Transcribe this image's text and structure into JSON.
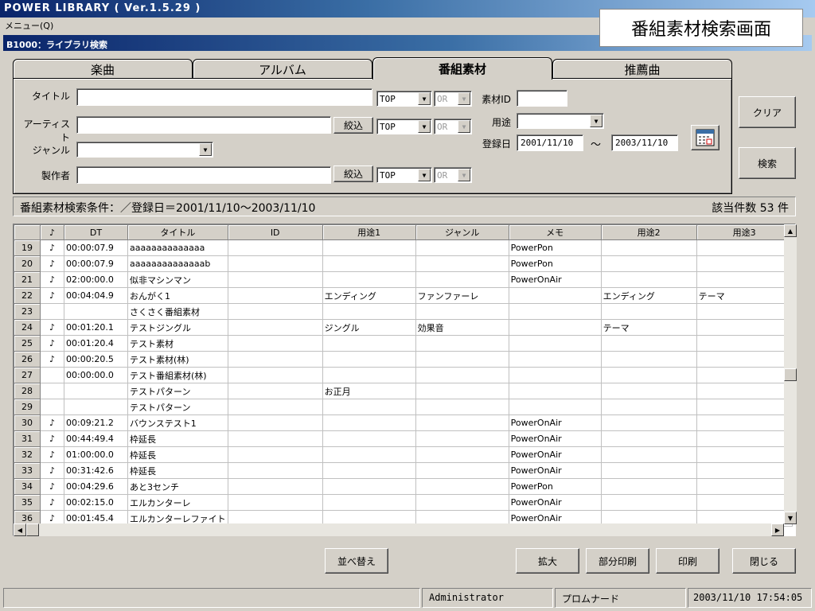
{
  "app": {
    "title": "POWER LIBRARY ( Ver.1.5.29 )",
    "menu": "メニュー(Q)",
    "window_title": "B1000：ライブラリ検索",
    "caption": "番組素材検索画面"
  },
  "tabs": [
    {
      "label": "楽曲"
    },
    {
      "label": "アルバム"
    },
    {
      "label": "番組素材"
    },
    {
      "label": "推薦曲"
    }
  ],
  "form": {
    "title_label": "タイトル",
    "artist_label": "アーティスト",
    "genre_label": "ジャンル",
    "producer_label": "製作者",
    "title_value": "",
    "artist_value": "",
    "genre_value": "",
    "producer_value": "",
    "narrow_label": "絞込",
    "top": "TOP",
    "or": "OR",
    "material_id_label": "素材ID",
    "material_id_value": "",
    "usage_label": "用途",
    "usage_value": "",
    "reg_date_label": "登録日",
    "date_from": "2001/11/10",
    "tilde": "～",
    "date_to": "2003/11/10"
  },
  "buttons": {
    "clear": "クリア",
    "search": "検索",
    "sort": "並べ替え",
    "zoom": "拡大",
    "partial_print": "部分印刷",
    "print": "印刷",
    "close": "閉じる"
  },
  "search_status": {
    "condition": "番組素材検索条件：／登録日＝2001/11/10～2003/11/10",
    "count": "該当件数 53 件"
  },
  "table": {
    "columns": [
      "♪",
      "DT",
      "タイトル",
      "ID",
      "用途1",
      "ジャンル",
      "メモ",
      "用途2",
      "用途3"
    ],
    "rows": [
      {
        "no": "19",
        "note": "♪",
        "dt": "00:00:07.9",
        "title": "aaaaaaaaaaaaaa",
        "id": "",
        "use1": "",
        "genre": "",
        "memo": "PowerPon",
        "use2": "",
        "use3": ""
      },
      {
        "no": "20",
        "note": "♪",
        "dt": "00:00:07.9",
        "title": "aaaaaaaaaaaaaab",
        "id": "",
        "use1": "",
        "genre": "",
        "memo": "PowerPon",
        "use2": "",
        "use3": ""
      },
      {
        "no": "21",
        "note": "♪",
        "dt": "02:00:00.0",
        "title": "似非マシンマン",
        "id": "",
        "use1": "",
        "genre": "",
        "memo": "PowerOnAir",
        "use2": "",
        "use3": ""
      },
      {
        "no": "22",
        "note": "♪",
        "dt": "00:04:04.9",
        "title": "おんがく1",
        "id": "",
        "use1": "エンディング",
        "genre": "ファンファーレ",
        "memo": "",
        "use2": "エンディング",
        "use3": "テーマ"
      },
      {
        "no": "23",
        "note": "",
        "dt": "",
        "title": "さくさく番組素材",
        "id": "",
        "use1": "",
        "genre": "",
        "memo": "",
        "use2": "",
        "use3": ""
      },
      {
        "no": "24",
        "note": "♪",
        "dt": "00:01:20.1",
        "title": "テストジングル",
        "id": "",
        "use1": "ジングル",
        "genre": "効果音",
        "memo": "",
        "use2": "テーマ",
        "use3": ""
      },
      {
        "no": "25",
        "note": "♪",
        "dt": "00:01:20.4",
        "title": "テスト素材",
        "id": "",
        "use1": "",
        "genre": "",
        "memo": "",
        "use2": "",
        "use3": ""
      },
      {
        "no": "26",
        "note": "♪",
        "dt": "00:00:20.5",
        "title": "テスト素材(林)",
        "id": "",
        "use1": "",
        "genre": "",
        "memo": "",
        "use2": "",
        "use3": ""
      },
      {
        "no": "27",
        "note": "",
        "dt": "00:00:00.0",
        "title": "テスト番組素材(林)",
        "id": "",
        "use1": "",
        "genre": "",
        "memo": "",
        "use2": "",
        "use3": ""
      },
      {
        "no": "28",
        "note": "",
        "dt": "",
        "title": "テストパターン",
        "id": "",
        "use1": "お正月",
        "genre": "",
        "memo": "",
        "use2": "",
        "use3": ""
      },
      {
        "no": "29",
        "note": "",
        "dt": "",
        "title": "テストパターン",
        "id": "",
        "use1": "",
        "genre": "",
        "memo": "",
        "use2": "",
        "use3": ""
      },
      {
        "no": "30",
        "note": "♪",
        "dt": "00:09:21.2",
        "title": "バウンステスト1",
        "id": "",
        "use1": "",
        "genre": "",
        "memo": "PowerOnAir",
        "use2": "",
        "use3": ""
      },
      {
        "no": "31",
        "note": "♪",
        "dt": "00:44:49.4",
        "title": "枠延長",
        "id": "",
        "use1": "",
        "genre": "",
        "memo": "PowerOnAir",
        "use2": "",
        "use3": ""
      },
      {
        "no": "32",
        "note": "♪",
        "dt": "01:00:00.0",
        "title": "枠延長",
        "id": "",
        "use1": "",
        "genre": "",
        "memo": "PowerOnAir",
        "use2": "",
        "use3": ""
      },
      {
        "no": "33",
        "note": "♪",
        "dt": "00:31:42.6",
        "title": "枠延長",
        "id": "",
        "use1": "",
        "genre": "",
        "memo": "PowerOnAir",
        "use2": "",
        "use3": ""
      },
      {
        "no": "34",
        "note": "♪",
        "dt": "00:04:29.6",
        "title": "あと3センチ",
        "id": "",
        "use1": "",
        "genre": "",
        "memo": "PowerPon",
        "use2": "",
        "use3": ""
      },
      {
        "no": "35",
        "note": "♪",
        "dt": "00:02:15.0",
        "title": "エルカンターレ",
        "id": "",
        "use1": "",
        "genre": "",
        "memo": "PowerOnAir",
        "use2": "",
        "use3": ""
      },
      {
        "no": "36",
        "note": "♪",
        "dt": "00:01:45.4",
        "title": "エルカンターレファイト",
        "id": "",
        "use1": "",
        "genre": "",
        "memo": "PowerOnAir",
        "use2": "",
        "use3": ""
      }
    ]
  },
  "statusbar": {
    "user": "Administrator",
    "place": "プロムナード",
    "datetime": "2003/11/10  17:54:05"
  },
  "icons": {
    "calendar": "calendar-icon",
    "scroll_up": "▲",
    "scroll_down": "▼",
    "scroll_left": "◀",
    "scroll_right": "▶",
    "dropdown": "▼"
  }
}
